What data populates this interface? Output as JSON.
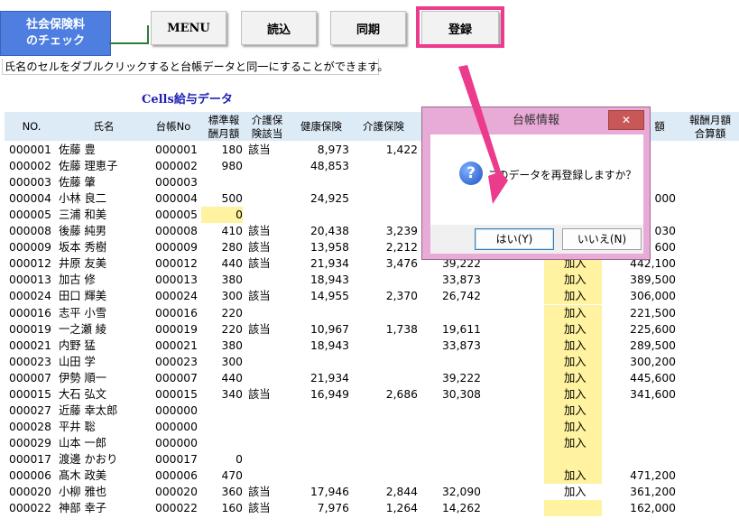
{
  "toolbar": {
    "blue_line1": "社会保険料",
    "blue_line2": "のチェック",
    "menu": "MENU",
    "load": "読込",
    "sync": "同期",
    "register": "登録"
  },
  "hint": "氏名のセルをダブルクリックすると台帳データと同一にすることができます。",
  "cells_title": "Cells給与データ",
  "headers": {
    "no": "NO.",
    "name": "氏名",
    "ledger": "台帳No",
    "std1": "標準報",
    "std2": "酬月額",
    "care1": "介護保",
    "care2": "険該当",
    "health": "健康保険",
    "care_ins": "介護保険",
    "col8_frag": "額",
    "total1": "報酬月額",
    "total2": "合算額"
  },
  "rows": [
    {
      "no": "000001",
      "name": "佐藤 豊",
      "ledger": "000001",
      "std": "180",
      "care": "該当",
      "health": "8,973",
      "careins": "1,422",
      "pension": "",
      "status": "",
      "total": ""
    },
    {
      "no": "000002",
      "name": "佐藤 理恵子",
      "ledger": "000002",
      "std": "980",
      "care": "",
      "health": "48,853",
      "careins": "",
      "pension": "",
      "status": "",
      "total": ""
    },
    {
      "no": "000003",
      "name": "佐藤 肇",
      "ledger": "000003",
      "std": "",
      "care": "",
      "health": "",
      "careins": "",
      "pension": "",
      "status": "",
      "total": ""
    },
    {
      "no": "000004",
      "name": "小林 良二",
      "ledger": "000004",
      "std": "500",
      "care": "",
      "health": "24,925",
      "careins": "",
      "pension": "",
      "status": "",
      "total": "000"
    },
    {
      "no": "000005",
      "name": "三浦 和美",
      "ledger": "000005",
      "std": "0",
      "care": "",
      "health": "",
      "careins": "",
      "pension": "",
      "status": "",
      "total": ""
    },
    {
      "no": "000008",
      "name": "後藤 純男",
      "ledger": "000008",
      "std": "410",
      "care": "該当",
      "health": "20,438",
      "careins": "3,239",
      "pension": "",
      "status": "",
      "total": "030"
    },
    {
      "no": "000009",
      "name": "坂本 秀樹",
      "ledger": "000009",
      "std": "280",
      "care": "該当",
      "health": "13,958",
      "careins": "2,212",
      "pension": "",
      "status": "",
      "total": "600"
    },
    {
      "no": "000012",
      "name": "井原 友美",
      "ledger": "000012",
      "std": "440",
      "care": "該当",
      "health": "21,934",
      "careins": "3,476",
      "pension": "39,222",
      "status": "加入",
      "total": "442,100"
    },
    {
      "no": "000013",
      "name": "加古 修",
      "ledger": "000013",
      "std": "380",
      "care": "",
      "health": "18,943",
      "careins": "",
      "pension": "33,873",
      "status": "加入",
      "total": "389,500"
    },
    {
      "no": "000024",
      "name": "田口 輝美",
      "ledger": "000024",
      "std": "300",
      "care": "該当",
      "health": "14,955",
      "careins": "2,370",
      "pension": "26,742",
      "status": "加入",
      "total": "306,000"
    },
    {
      "no": "000016",
      "name": "志平 小雪",
      "ledger": "000016",
      "std": "220",
      "care": "",
      "health": "",
      "careins": "",
      "pension": "",
      "status": "加入",
      "total": "221,500"
    },
    {
      "no": "000019",
      "name": "一之瀬 綾",
      "ledger": "000019",
      "std": "220",
      "care": "該当",
      "health": "10,967",
      "careins": "1,738",
      "pension": "19,611",
      "status": "加入",
      "total": "225,600"
    },
    {
      "no": "000021",
      "name": "内野 猛",
      "ledger": "000021",
      "std": "380",
      "care": "",
      "health": "18,943",
      "careins": "",
      "pension": "33,873",
      "status": "加入",
      "total": "289,500"
    },
    {
      "no": "000023",
      "name": "山田 学",
      "ledger": "000023",
      "std": "300",
      "care": "",
      "health": "",
      "careins": "",
      "pension": "",
      "status": "加入",
      "total": "300,200"
    },
    {
      "no": "000007",
      "name": "伊勢 順一",
      "ledger": "000007",
      "std": "440",
      "care": "",
      "health": "21,934",
      "careins": "",
      "pension": "39,222",
      "status": "加入",
      "total": "445,600"
    },
    {
      "no": "000015",
      "name": "大石 弘文",
      "ledger": "000015",
      "std": "340",
      "care": "該当",
      "health": "16,949",
      "careins": "2,686",
      "pension": "30,308",
      "status": "加入",
      "total": "341,600"
    },
    {
      "no": "000027",
      "name": "近藤 幸太郎",
      "ledger": "000000",
      "std": "",
      "care": "",
      "health": "",
      "careins": "",
      "pension": "",
      "status": "加入",
      "total": ""
    },
    {
      "no": "000028",
      "name": "平井 聡",
      "ledger": "000000",
      "std": "",
      "care": "",
      "health": "",
      "careins": "",
      "pension": "",
      "status": "加入",
      "total": ""
    },
    {
      "no": "000029",
      "name": "山本 一郎",
      "ledger": "000000",
      "std": "",
      "care": "",
      "health": "",
      "careins": "",
      "pension": "",
      "status": "加入",
      "total": ""
    },
    {
      "no": "000017",
      "name": "渡邊 かおり",
      "ledger": "000017",
      "std": "0",
      "care": "",
      "health": "",
      "careins": "",
      "pension": "",
      "status": "",
      "total": ""
    },
    {
      "no": "000006",
      "name": "髙木 政美",
      "ledger": "000006",
      "std": "470",
      "care": "",
      "health": "",
      "careins": "",
      "pension": "",
      "status": "加入",
      "total": "471,200"
    },
    {
      "no": "000020",
      "name": "小柳 雅也",
      "ledger": "000020",
      "std": "360",
      "care": "該当",
      "health": "17,946",
      "careins": "2,844",
      "pension": "32,090",
      "status": "加入",
      "total": "361,200"
    },
    {
      "no": "000022",
      "name": "神部 幸子",
      "ledger": "000022",
      "std": "160",
      "care": "該当",
      "health": "7,976",
      "careins": "1,264",
      "pension": "14,262",
      "status": "",
      "total": "162,000"
    }
  ],
  "dialog": {
    "title": "台帳情報",
    "close": "✕",
    "icon": "?",
    "message": "このデータを再登録しますか？",
    "yes": "はい(Y)",
    "no": "いいえ(N)"
  },
  "colors": {
    "accent_pink": "#ec3a8c",
    "header_blue": "#ddebf7",
    "highlight_yellow": "#fff2a0",
    "button_blue": "#4d7ee0"
  }
}
